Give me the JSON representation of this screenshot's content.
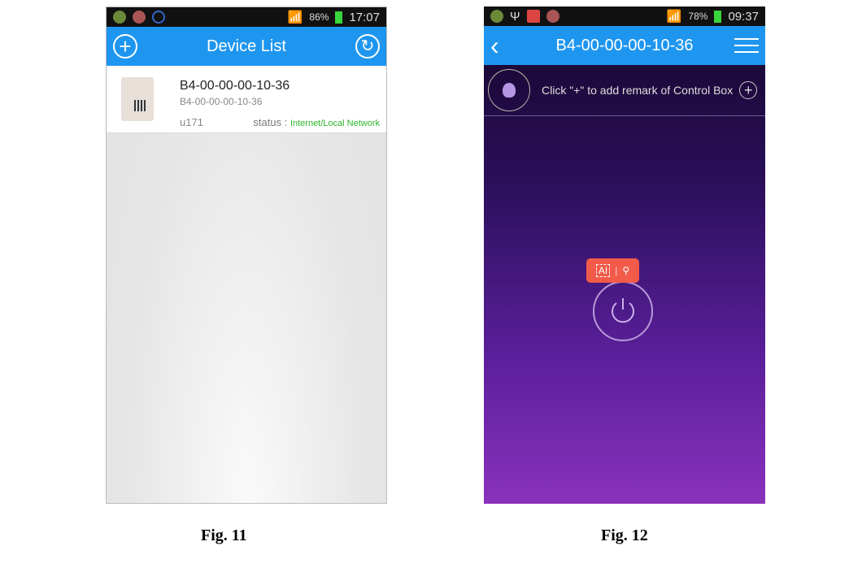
{
  "fig11": {
    "status": {
      "battery": "86%",
      "time": "17:07"
    },
    "header": {
      "title": "Device List",
      "add_icon": "plus-circle-icon",
      "refresh_icon": "refresh-icon"
    },
    "device": {
      "name": "B4-00-00-00-10-36",
      "mac": "B4-00-00-00-10-36",
      "user": "u171",
      "status_label": "status :",
      "status_value": "Internet/Local Network",
      "status_color": "#2ab52a"
    },
    "caption": "Fig. 11"
  },
  "fig12": {
    "status": {
      "battery": "78%",
      "time": "09:37"
    },
    "header": {
      "title": "B4-00-00-00-10-36",
      "back_icon": "chevron-left-icon",
      "menu_icon": "menu-icon"
    },
    "remark_text": "Click \"+\" to add remark of Control Box",
    "ai_label": "AI",
    "caption": "Fig. 12"
  }
}
